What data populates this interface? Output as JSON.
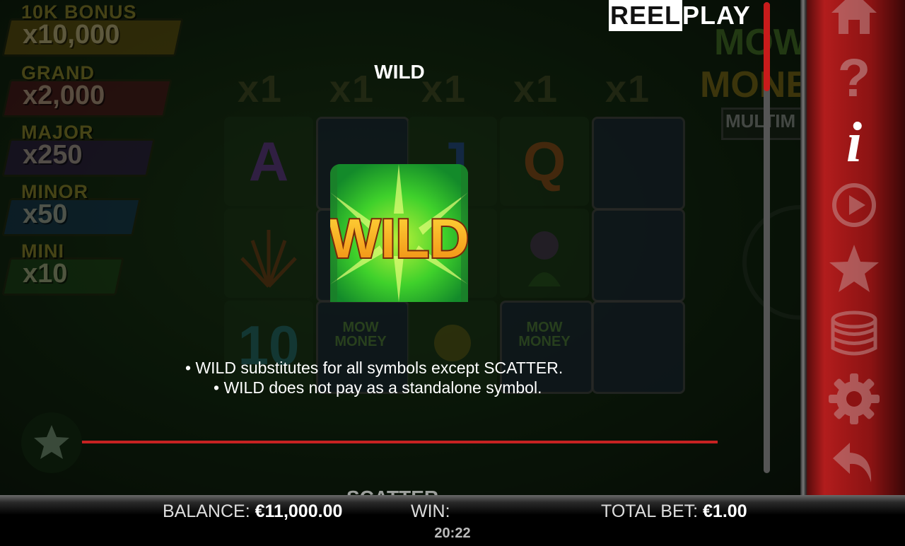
{
  "jackpots": [
    {
      "name": "10K BONUS",
      "value": "x10,000",
      "color": "#d8b020"
    },
    {
      "name": "GRAND",
      "value": "x2,000",
      "color": "#b3283a"
    },
    {
      "name": "MAJOR",
      "value": "x250",
      "color": "#5a2f8c"
    },
    {
      "name": "MINOR",
      "value": "x50",
      "color": "#2a6fb8"
    },
    {
      "name": "MINI",
      "value": "x10",
      "color": "#3c8a2c"
    }
  ],
  "multipliers": [
    "x1",
    "x1",
    "x1",
    "x1",
    "x1"
  ],
  "reels": {
    "letters": [
      "A",
      "J",
      "Q",
      "10"
    ],
    "mow_money": "MOW MONEY"
  },
  "brand": {
    "reel": "REEL",
    "play": "PLAY"
  },
  "game_logo": {
    "line1": "MOW",
    "line2": "MONEY",
    "line3": "MULTIM"
  },
  "paytable": {
    "title": "WILD",
    "symbol_text": "WILD",
    "description": [
      "• WILD substitutes for all symbols except SCATTER.",
      "• WILD does not pay as a standalone symbol."
    ],
    "next_section_peek": "SCATTER"
  },
  "sidebar": [
    "home-icon",
    "help-icon",
    "info-icon",
    "autoplay-icon",
    "favorite-icon",
    "coins-icon",
    "settings-icon",
    "back-icon"
  ],
  "status": {
    "balance_label": "BALANCE:",
    "balance_value": "€11,000.00",
    "win_label": "WIN:",
    "win_value": "",
    "bet_label": "TOTAL BET:",
    "bet_value": "€1.00",
    "clock": "20:22"
  },
  "colors": {
    "accent": "#c81b1b",
    "sidebar": "#b21d1d",
    "wild_green": "#3fd12b",
    "wild_gold": "#f3b41b"
  }
}
